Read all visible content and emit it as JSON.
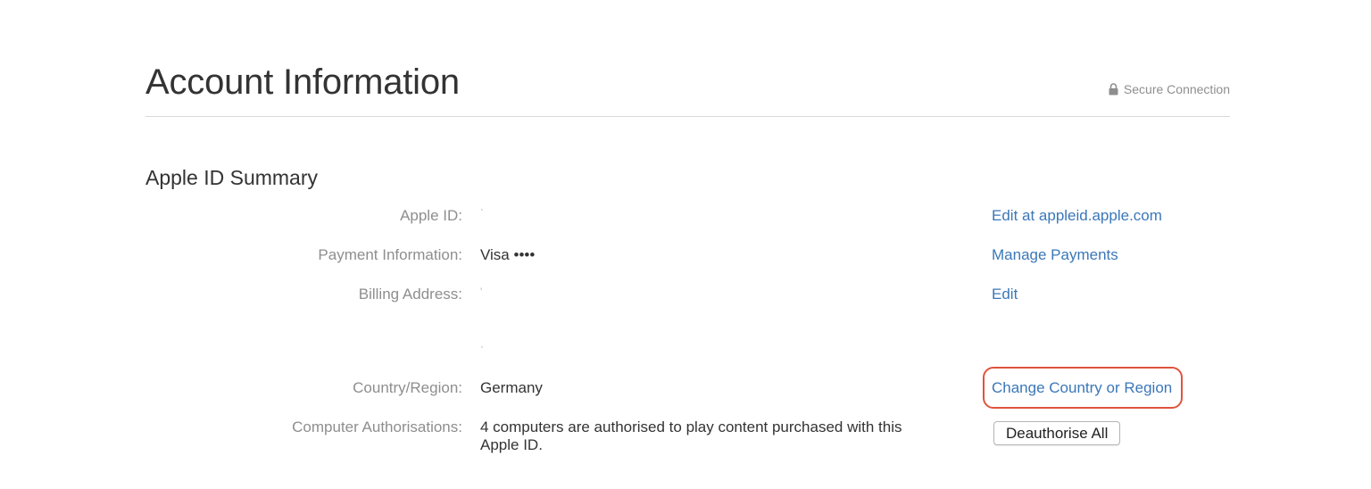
{
  "header": {
    "title": "Account Information",
    "secure_label": "Secure Connection",
    "secure_icon": "lock-icon"
  },
  "summary": {
    "title": "Apple ID Summary",
    "apple_id": {
      "label": "Apple ID:",
      "value": "`",
      "action": "Edit at appleid.apple.com"
    },
    "payment": {
      "label": "Payment Information:",
      "value": "Visa ••••",
      "action": "Manage Payments"
    },
    "billing": {
      "label": "Billing Address:",
      "value_line1": "'",
      "value_line2": "`",
      "action": "Edit"
    },
    "country": {
      "label": "Country/Region:",
      "value": "Germany",
      "action": "Change Country or Region"
    },
    "computers": {
      "label": "Computer Authorisations:",
      "value": "4 computers are authorised to play content purchased with this Apple ID.",
      "button": "Deauthorise All"
    }
  },
  "colors": {
    "link": "#3b77b8",
    "label": "#8e8e8e",
    "text": "#333333",
    "highlight": "#e0533d"
  }
}
